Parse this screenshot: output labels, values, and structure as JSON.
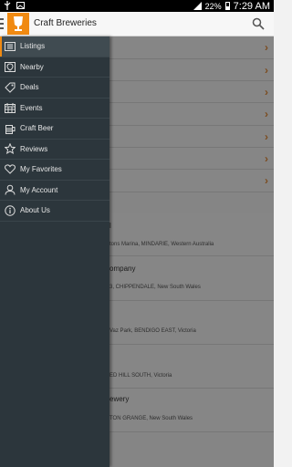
{
  "status": {
    "battery_pct": "22%",
    "time": "7:29 AM"
  },
  "appbar": {
    "title": "Craft Breweries"
  },
  "drawer": {
    "items": [
      {
        "label": "Listings",
        "icon": "list-icon",
        "active": true
      },
      {
        "label": "Nearby",
        "icon": "map-pin-icon"
      },
      {
        "label": "Deals",
        "icon": "tag-icon"
      },
      {
        "label": "Events",
        "icon": "calendar-icon"
      },
      {
        "label": "Craft Beer",
        "icon": "beer-icon"
      },
      {
        "label": "Reviews",
        "icon": "star-icon"
      },
      {
        "label": "My Favorites",
        "icon": "heart-icon"
      },
      {
        "label": "My Account",
        "icon": "user-icon"
      },
      {
        "label": "About Us",
        "icon": "info-icon"
      }
    ]
  },
  "background_list": {
    "rows": [
      {
        "name": "l",
        "address": "tons Marina, MINDARIE, Western Australia"
      },
      {
        "name": "ompany",
        "address": "3, CHIPPENDALE, New South Wales"
      },
      {
        "name": "",
        "address": "Vaz Park, BENDIGO EAST, Victoria"
      },
      {
        "name": "",
        "address": "ED HILL SOUTH, Victoria"
      },
      {
        "name": "ewery",
        "address": "TON GRANGE, New South Wales"
      }
    ]
  },
  "colors": {
    "accent": "#f08a12",
    "drawer_bg": "#2c363c",
    "chevron": "#e08a3a"
  }
}
